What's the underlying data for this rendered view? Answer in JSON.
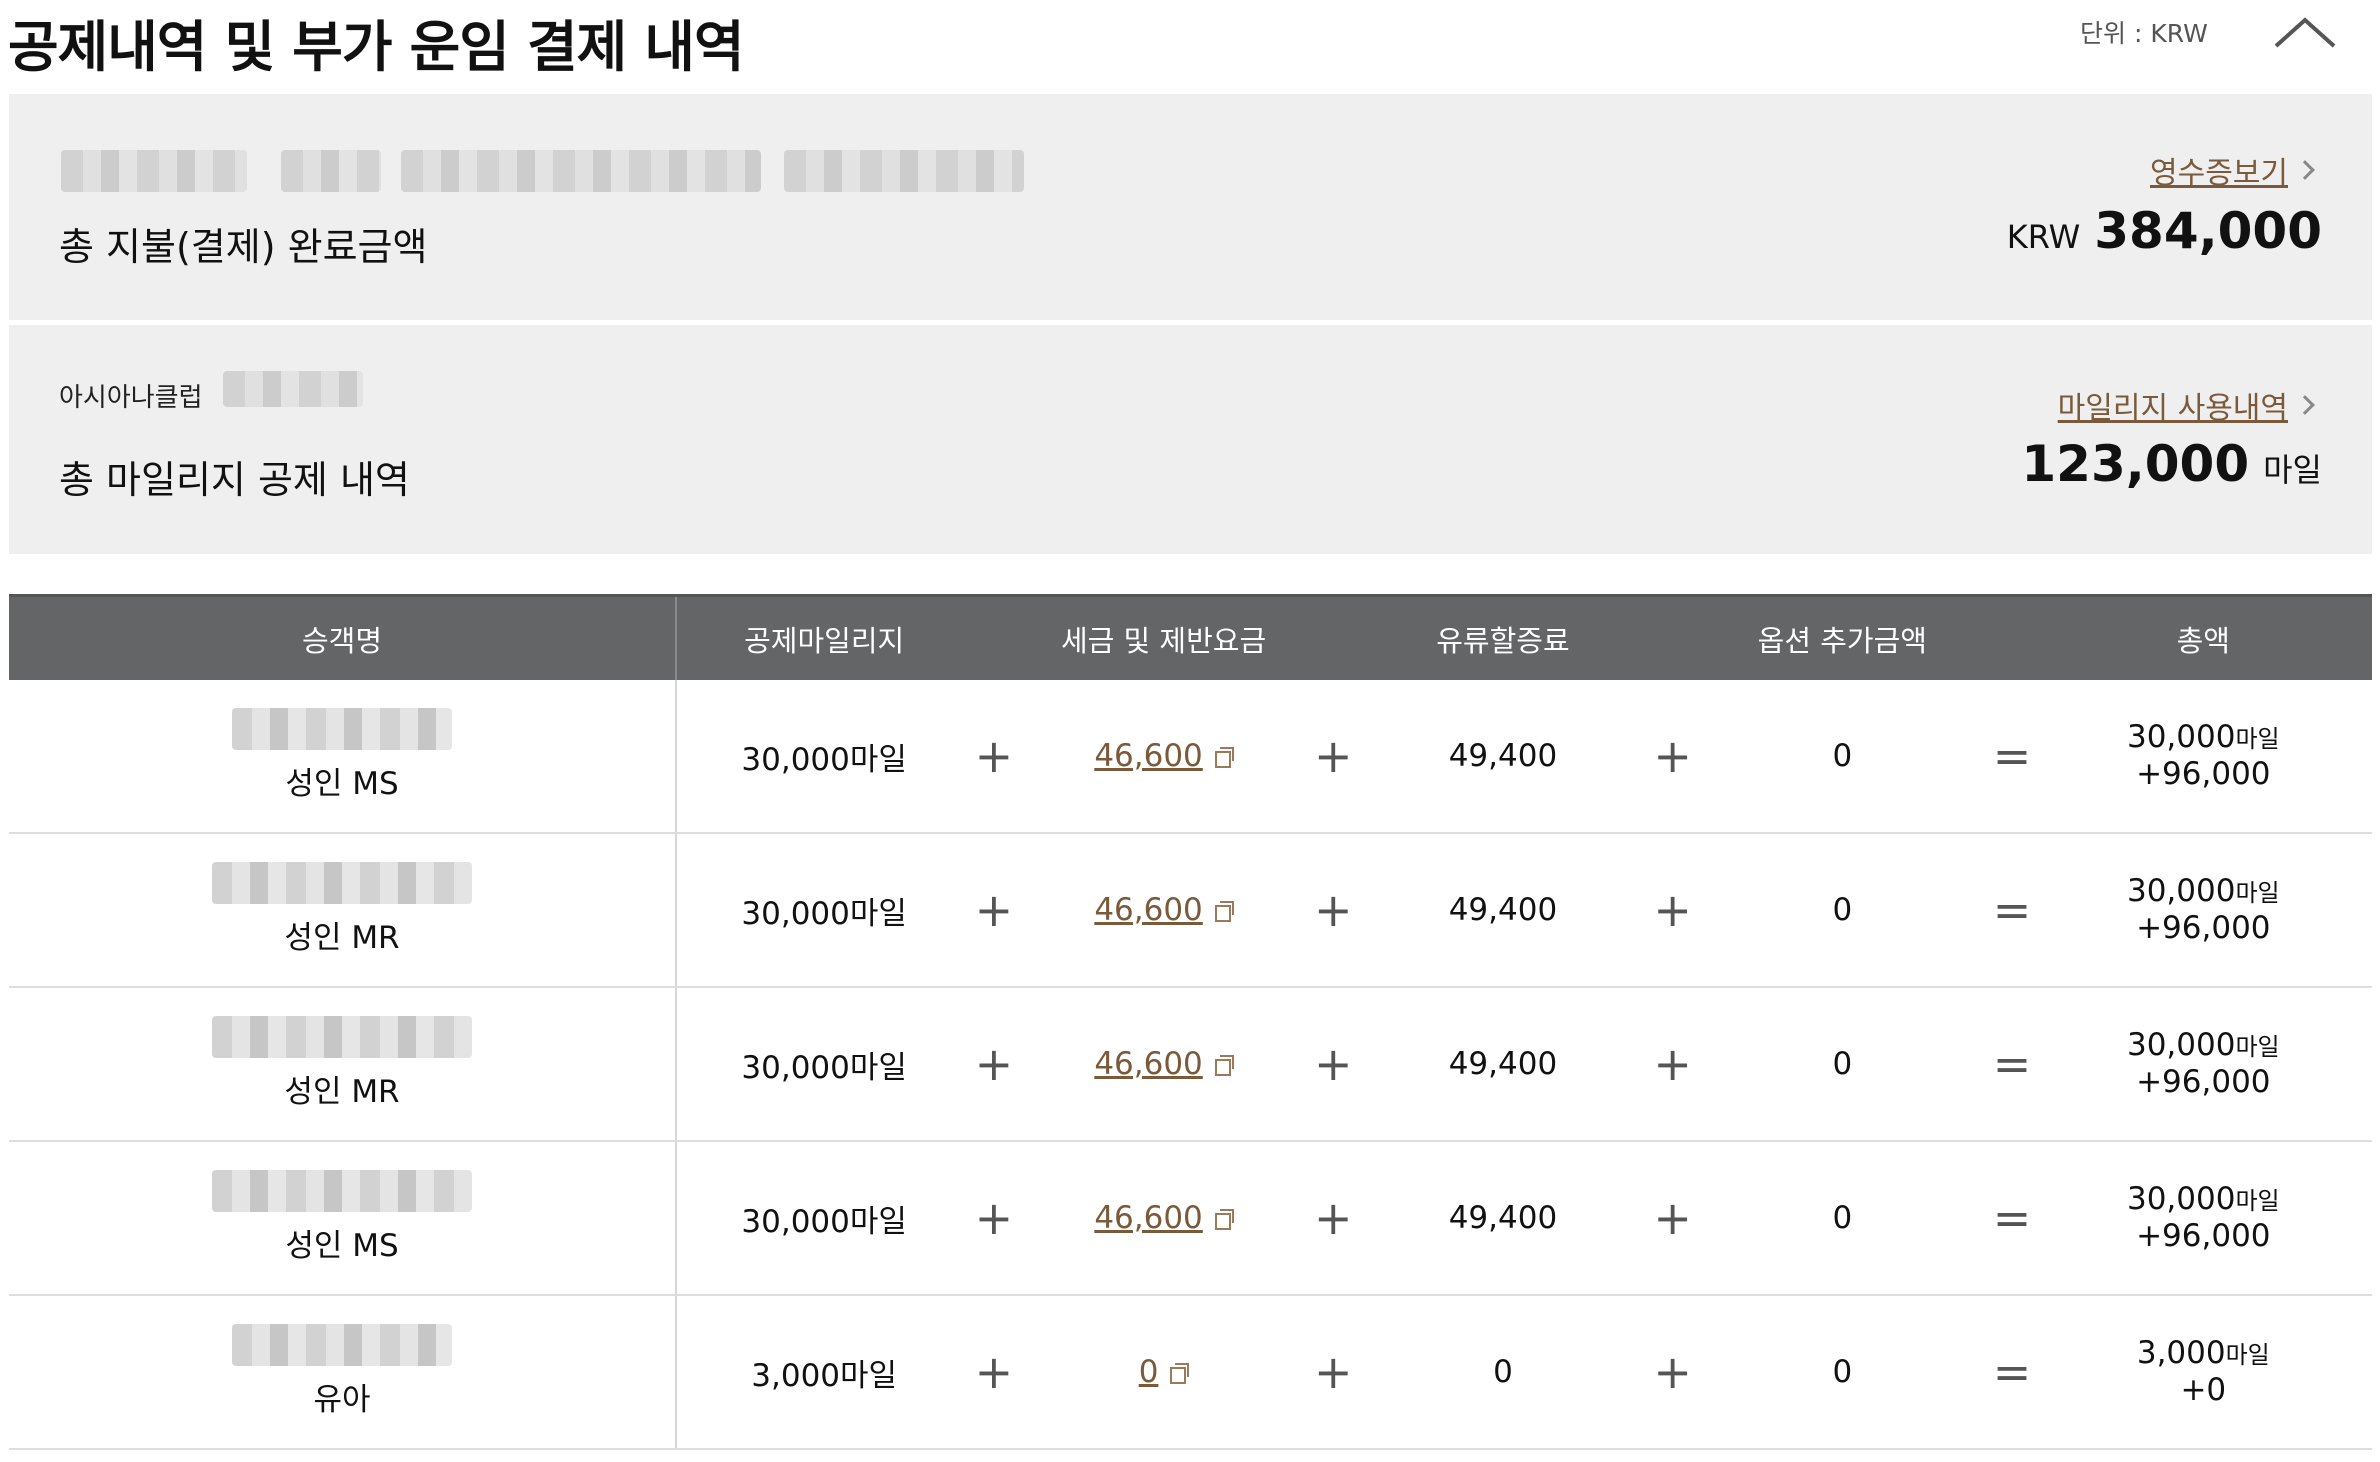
{
  "header": {
    "title": "공제내역 및 부가 운임 결제 내역",
    "unit": "단위 : KRW"
  },
  "payment": {
    "label": "총 지불(결제) 완료금액",
    "receipt_link": "영수증보기",
    "currency": "KRW",
    "amount": "384,000"
  },
  "mileage": {
    "club_label": "아시아나클럽",
    "label": "총 마일리지 공제 내역",
    "history_link": "마일리지 사용내역",
    "amount": "123,000",
    "unit": "마일"
  },
  "table": {
    "headers": [
      "승객명",
      "공제마일리지",
      "세금 및 제반요금",
      "유류할증료",
      "옵션 추가금액",
      "총액"
    ],
    "operators": {
      "plus": "+",
      "equals": "="
    },
    "rows": [
      {
        "type": "성인 MS",
        "miles": "30,000마일",
        "tax": "46,600",
        "fuel": "49,400",
        "option": "0",
        "total_miles": "30,000",
        "total_miles_unit": "마일",
        "total_amount": "+96,000"
      },
      {
        "type": "성인 MR",
        "miles": "30,000마일",
        "tax": "46,600",
        "fuel": "49,400",
        "option": "0",
        "total_miles": "30,000",
        "total_miles_unit": "마일",
        "total_amount": "+96,000"
      },
      {
        "type": "성인 MR",
        "miles": "30,000마일",
        "tax": "46,600",
        "fuel": "49,400",
        "option": "0",
        "total_miles": "30,000",
        "total_miles_unit": "마일",
        "total_amount": "+96,000"
      },
      {
        "type": "성인 MS",
        "miles": "30,000마일",
        "tax": "46,600",
        "fuel": "49,400",
        "option": "0",
        "total_miles": "30,000",
        "total_miles_unit": "마일",
        "total_amount": "+96,000"
      },
      {
        "type": "유아",
        "miles": "3,000마일",
        "tax": "0",
        "fuel": "0",
        "option": "0",
        "total_miles": "3,000",
        "total_miles_unit": "마일",
        "total_amount": "+0"
      }
    ]
  },
  "icons": {
    "collapse": "chevron-up-icon",
    "link_arrow": "chevron-right-icon",
    "copy": "copy-icon"
  },
  "colors": {
    "header_bg": "#646566",
    "summary_bg": "#efefef",
    "link": "#7a5a3a"
  }
}
